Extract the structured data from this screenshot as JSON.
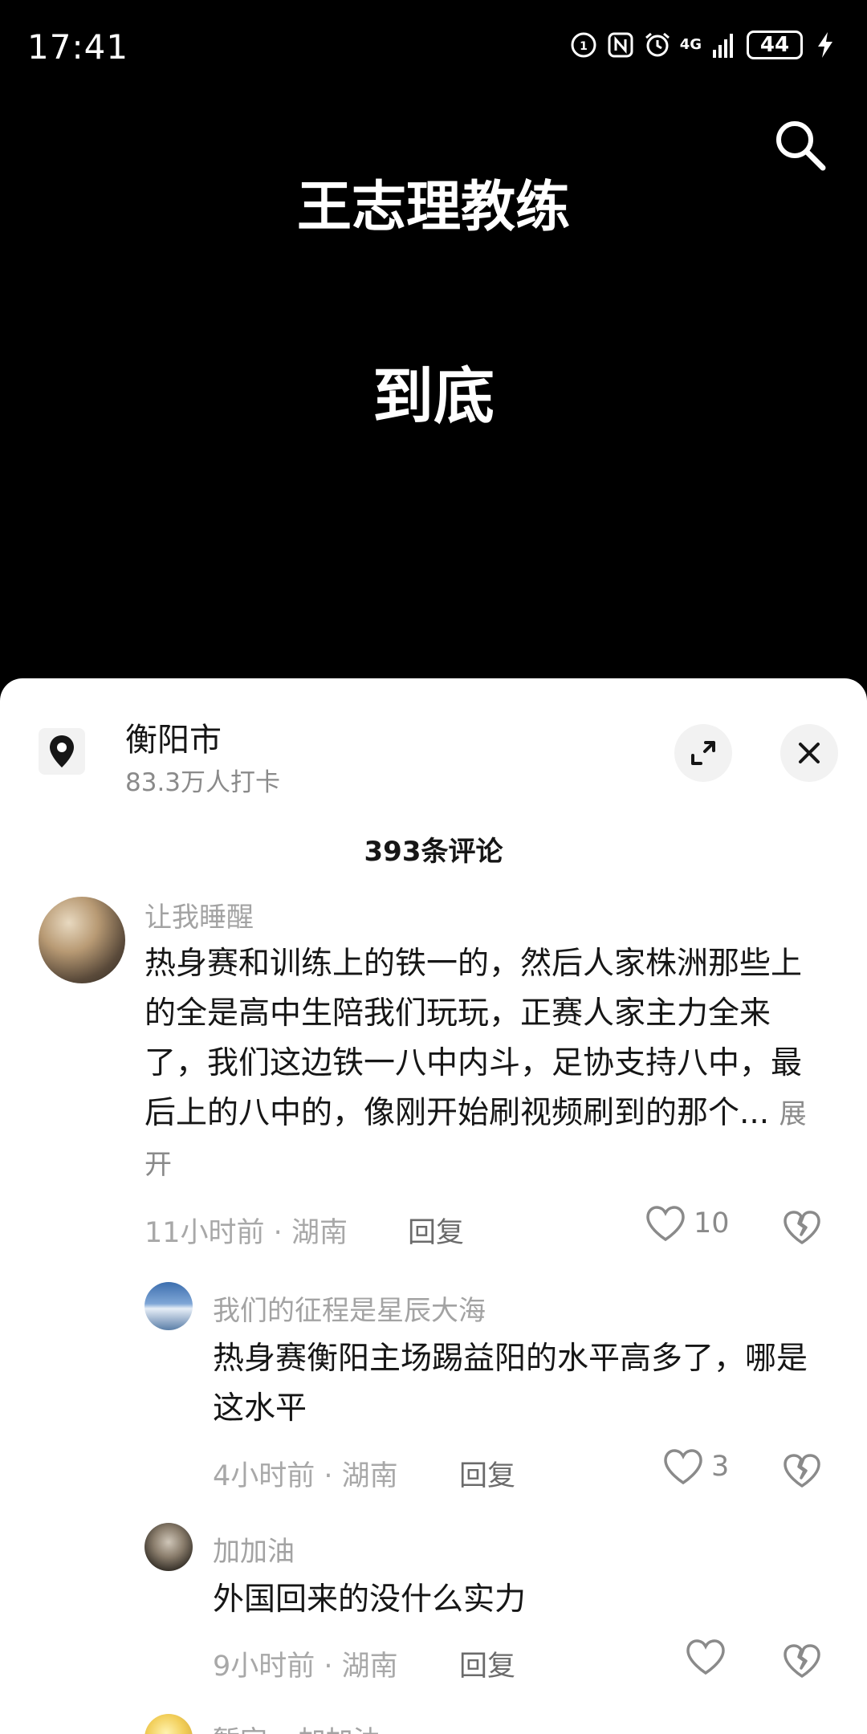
{
  "status_bar": {
    "time": "17:41",
    "network": "4G",
    "battery": "44",
    "icons": [
      "hd-voice-icon",
      "nfc-icon",
      "alarm-icon",
      "signal-icon",
      "battery-icon",
      "charging-icon"
    ]
  },
  "video": {
    "line1": "王志理教练",
    "line2": "到底",
    "search_icon": "search-icon"
  },
  "sheet": {
    "location_name": "衡阳市",
    "location_checkins": "83.3万人打卡",
    "comment_count": "393条评论"
  },
  "comments": [
    {
      "username": "让我睡醒",
      "text": "热身赛和训练上的铁一的，然后人家株洲那些上的全是高中生陪我们玩玩，正赛人家主力全来了，我们这边铁一八中内斗，足协支持八中，最后上的八中的，像刚开始刷视频刷到的那个...",
      "expand": "展开",
      "time": "11小时前",
      "region": "湖南",
      "reply": "回复",
      "likes": "10"
    },
    {
      "username": "我们的征程是星辰大海",
      "text": "热身赛衡阳主场踢益阳的水平高多了，哪是这水平",
      "time": "4小时前",
      "region": "湖南",
      "reply": "回复",
      "likes": "3"
    },
    {
      "username": "加加油",
      "text": "外国回来的没什么实力",
      "time": "9小时前",
      "region": "湖南",
      "reply": "回复",
      "likes": ""
    },
    {
      "username": "暂定 ▸ 加加油"
    }
  ],
  "meta_separator": " · "
}
